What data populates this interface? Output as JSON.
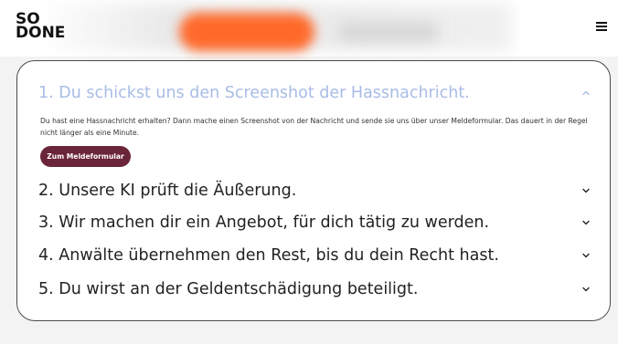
{
  "header": {
    "logo_line1": "SO",
    "logo_line2": "DONE"
  },
  "accordion": {
    "items": [
      {
        "title": "1. Du schickst uns den Screenshot der Hassnachricht.",
        "expanded": true,
        "body": "Du hast eine Hassnachricht erhalten? Dann mache einen Screenshot von der Nachricht und sende sie uns über unser Meldeformular. Das dauert in der Regel nicht länger als eine Minute.",
        "button_label": "Zum Meldeformular"
      },
      {
        "title": "2. Unsere KI prüft die Äußerung.",
        "expanded": false
      },
      {
        "title": "3. Wir machen dir ein Angebot, für dich tätig zu werden.",
        "expanded": false
      },
      {
        "title": "4. Anwälte übernehmen den Rest, bis du dein Recht hast.",
        "expanded": false
      },
      {
        "title": "5. Du wirst an der Geldentschädigung beteiligt.",
        "expanded": false
      }
    ]
  },
  "colors": {
    "open_title": "#a9bce6",
    "button_bg": "#6b2538",
    "header_accent": "#ff6a2b"
  }
}
